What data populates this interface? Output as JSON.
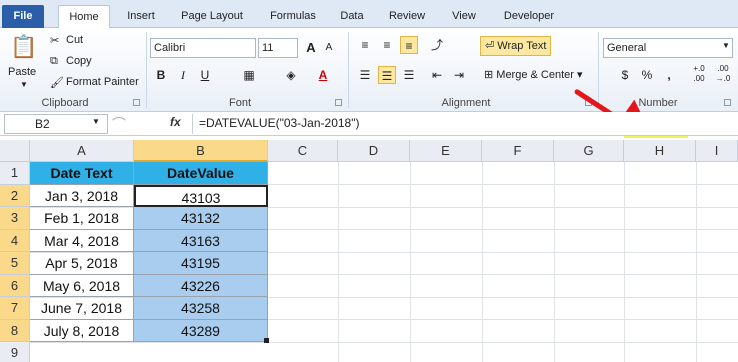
{
  "tabs": [
    "File",
    "Home",
    "Insert",
    "Page Layout",
    "Formulas",
    "Data",
    "Review",
    "View",
    "Developer"
  ],
  "ribbon": {
    "clipboard": {
      "paste": "Paste",
      "cut": "Cut",
      "copy": "Copy",
      "format_painter": "Format Painter",
      "label": "Clipboard"
    },
    "font": {
      "name": "Calibri",
      "size": "11",
      "grow": "A",
      "shrink": "A",
      "bold": "B",
      "italic": "I",
      "underline": "U",
      "label": "Font"
    },
    "alignment": {
      "wrap_text": "Wrap Text",
      "merge_center": "Merge & Center",
      "label": "Alignment"
    },
    "number": {
      "format": "General",
      "percent": "%",
      "comma": ",",
      "inc_decimal": "+.0 .00",
      "dec_decimal": ".00 →.0",
      "label": "Number"
    }
  },
  "formula_bar": {
    "name_box": "B2",
    "fx": "fx",
    "formula": "=DATEVALUE(\"03-Jan-2018\")"
  },
  "columns": [
    "A",
    "B",
    "C",
    "D",
    "E",
    "F",
    "G",
    "H",
    "I"
  ],
  "rows": [
    "1",
    "2",
    "3",
    "4",
    "5",
    "6",
    "7",
    "8",
    "9"
  ],
  "table": {
    "headers": [
      "Date Text",
      "DateValue"
    ],
    "data": [
      [
        "Jan 3, 2018",
        "43103"
      ],
      [
        "Feb 1, 2018",
        "43132"
      ],
      [
        "Mar 4, 2018",
        "43163"
      ],
      [
        "Apr 5, 2018",
        "43195"
      ],
      [
        "May 6, 2018",
        "43226"
      ],
      [
        "June 7, 2018",
        "43258"
      ],
      [
        "July 8, 2018",
        "43289"
      ]
    ]
  },
  "colors": {
    "header_fill": "#2fb0e6",
    "selection_fill": "#a9cdee",
    "annotation_arrow": "#e4161b",
    "annotation_highlight": "#f2f25a"
  }
}
